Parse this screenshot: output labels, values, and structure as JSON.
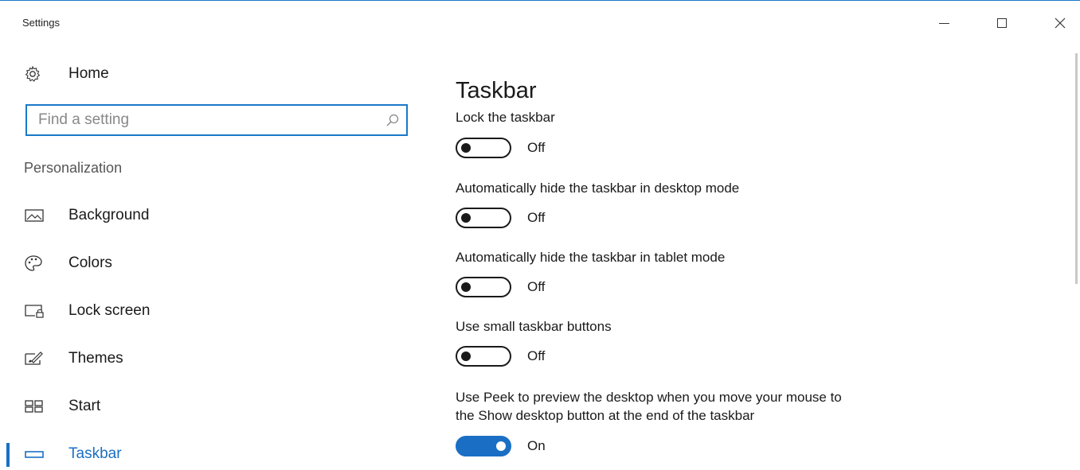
{
  "window": {
    "title": "Settings",
    "accent_color": "#1a6fc4",
    "controls": {
      "minimize": "minimize-icon",
      "maximize": "maximize-icon",
      "close": "close-icon"
    }
  },
  "sidebar": {
    "home_label": "Home",
    "search": {
      "placeholder": "Find a setting",
      "value": ""
    },
    "section_header": "Personalization",
    "items": [
      {
        "label": "Background",
        "icon": "picture-icon"
      },
      {
        "label": "Colors",
        "icon": "palette-icon"
      },
      {
        "label": "Lock screen",
        "icon": "lock-screen-icon"
      },
      {
        "label": "Themes",
        "icon": "themes-brush-icon"
      },
      {
        "label": "Start",
        "icon": "start-grid-icon"
      },
      {
        "label": "Taskbar",
        "icon": "taskbar-icon",
        "selected": true
      }
    ]
  },
  "main": {
    "title": "Taskbar",
    "settings": [
      {
        "label": "Lock the taskbar",
        "state": "Off",
        "on": false
      },
      {
        "label": "Automatically hide the taskbar in desktop mode",
        "state": "Off",
        "on": false
      },
      {
        "label": "Automatically hide the taskbar in tablet mode",
        "state": "Off",
        "on": false
      },
      {
        "label": "Use small taskbar buttons",
        "state": "Off",
        "on": false
      },
      {
        "label_line1": "Use Peek to preview the desktop when you move your mouse to",
        "label_line2": "the Show desktop button at the end of the taskbar",
        "state": "On",
        "on": true
      }
    ]
  }
}
